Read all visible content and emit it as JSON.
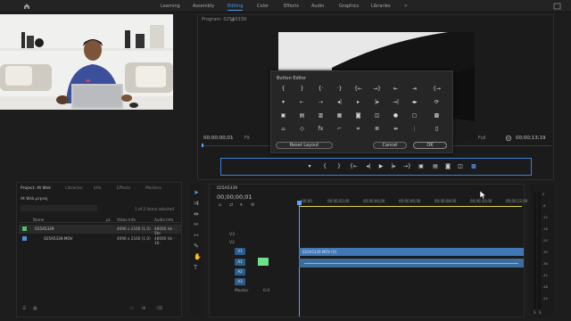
{
  "workspace_tabs": [
    "Learning",
    "Assembly",
    "Editing",
    "Color",
    "Effects",
    "Audio",
    "Graphics",
    "Libraries"
  ],
  "active_workspace": "Editing",
  "program_monitor": {
    "title": "Program: 025A5339",
    "timecode_left": "00;00;00;01",
    "fit_label": "Fit",
    "quality_label": "Full",
    "timecode_right": "00;00;13;19"
  },
  "button_editor": {
    "title": "Button Editor",
    "reset_label": "Reset Layout",
    "cancel_label": "Cancel",
    "ok_label": "OK"
  },
  "project_panel": {
    "tabs": [
      "Project: At Wsk",
      "Libraries",
      "Info",
      "Effects",
      "Markers"
    ],
    "active_tab": "Project: At Wsk",
    "project_file": "At Wsk.prproj",
    "items_selected": "1 of 2 items selected",
    "columns": {
      "name": "Name",
      "fps": "ps",
      "video_info": "Video Info",
      "audio_info": "Audio Info"
    },
    "rows": [
      {
        "name": "025A5339",
        "video_info": "4096 x 2160 (1.0)",
        "audio_info": "48000 Hz - Ste"
      },
      {
        "name": "025A5339.MOV",
        "video_info": "4096 x 2160 (1.0)",
        "audio_info": "48000 Hz - 16-"
      }
    ]
  },
  "timeline": {
    "tab": "025A5339",
    "timecode": "00;00;00;01",
    "ruler": [
      ";00;00",
      "00;00;02;00",
      "00;00;04;00",
      "00;00;06;00",
      "00;00;08;00",
      "00;00;10;00",
      "00;00;12;00",
      "00;00;14;00"
    ],
    "video_tracks": [
      "V3",
      "V2",
      "V1"
    ],
    "audio_tracks": [
      "A1",
      "A2",
      "A3"
    ],
    "mix_label": "Master",
    "mix_value": "0.0",
    "clip_video": "025A5339.MOV [V]"
  },
  "meters": {
    "scale": [
      "0",
      "-6",
      "-12",
      "-18",
      "-24",
      "-30",
      "-36",
      "-42",
      "-48",
      "-54"
    ],
    "footer": [
      "S",
      "S"
    ]
  },
  "colors": {
    "accent": "#4b97e8",
    "clip_video": "#3f78b4",
    "clip_audio": "#3b6e9c",
    "playhead": "#5ea1ff",
    "green_chip": "#6fe08a"
  }
}
